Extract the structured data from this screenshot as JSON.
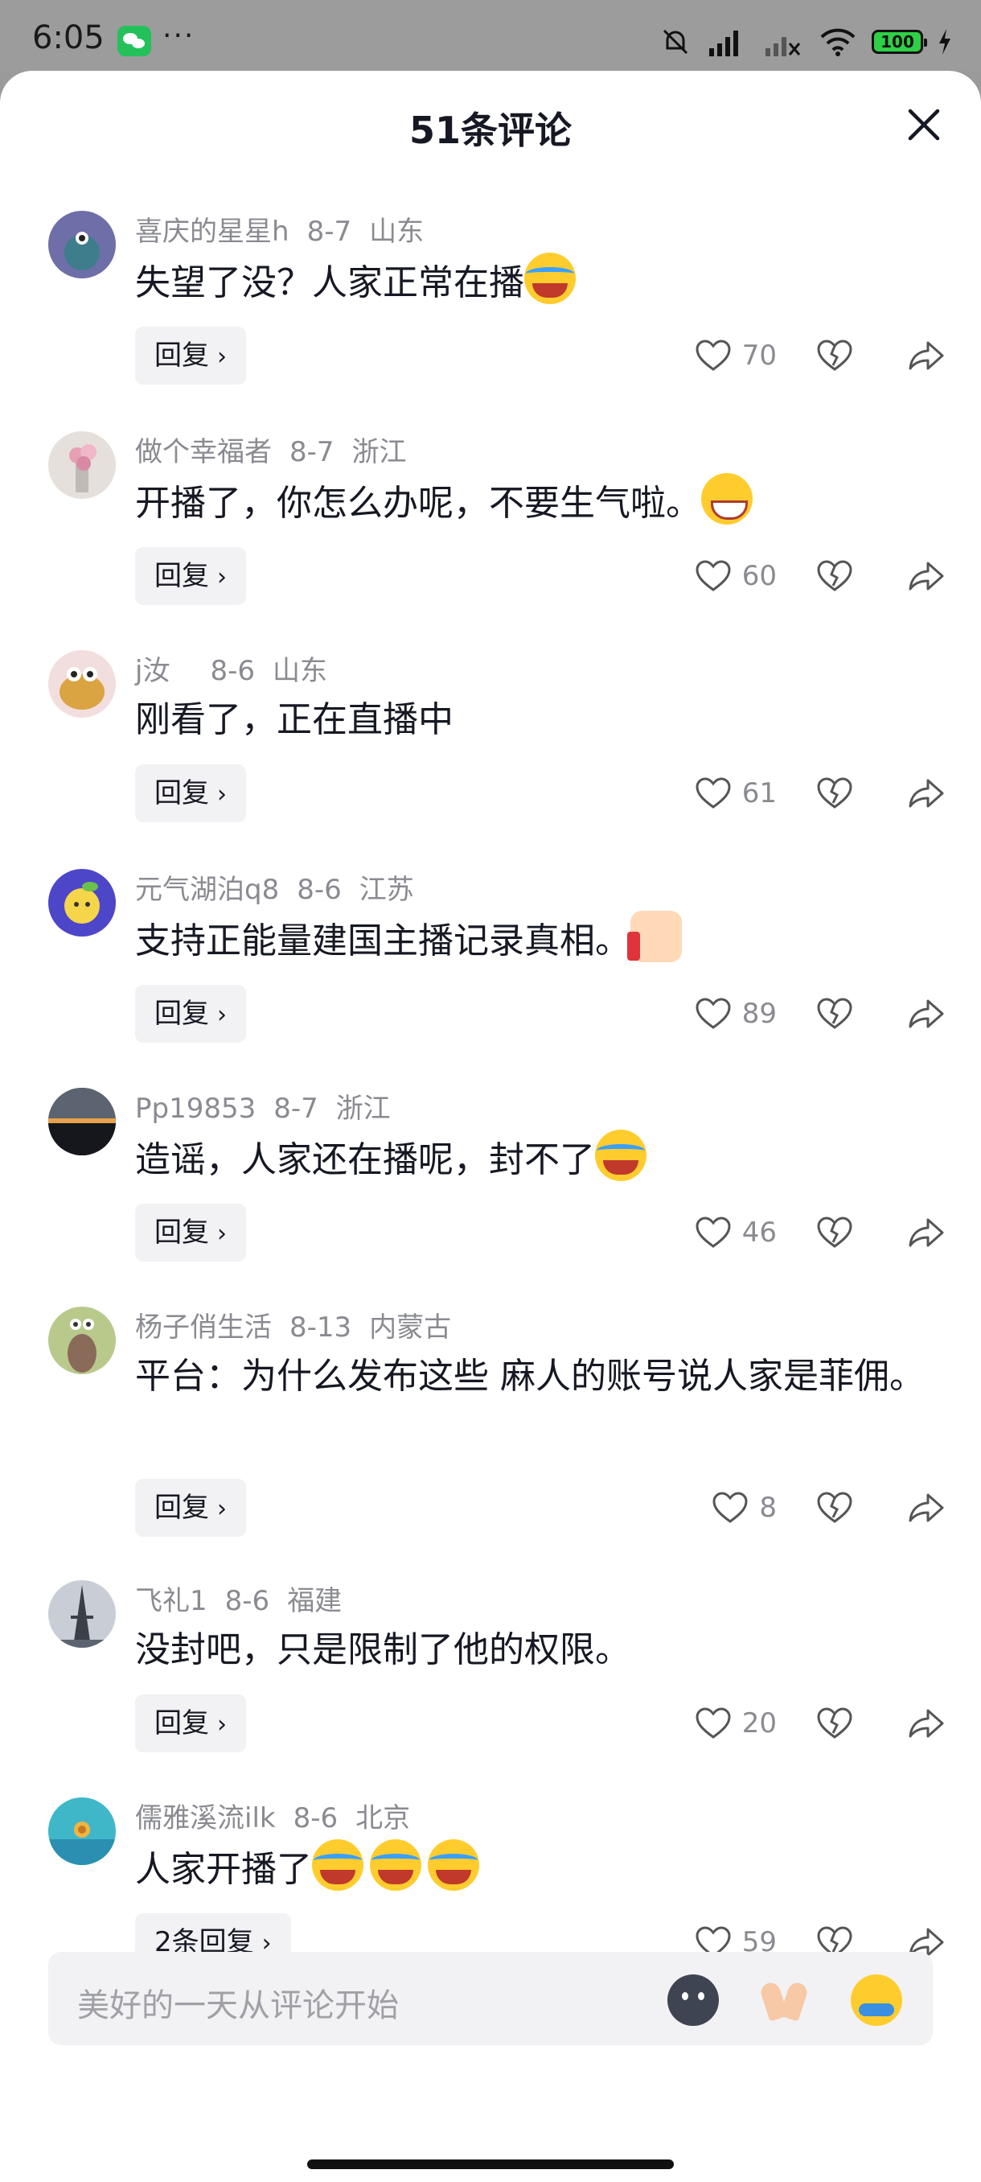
{
  "status_bar": {
    "time": "6:05",
    "battery": "100"
  },
  "sheet": {
    "title": "51条评论"
  },
  "comments": [
    {
      "user": "喜庆的星星h",
      "date": "8-7",
      "region": "山东",
      "text": "失望了没？人家正常在播",
      "reply_label": "回复",
      "likes": "70"
    },
    {
      "user": "做个幸福者",
      "date": "8-7",
      "region": "浙江",
      "text": "开播了，你怎么办呢，不要生气啦。",
      "reply_label": "回复",
      "likes": "60"
    },
    {
      "user": "j汝",
      "date": "8-6",
      "region": "山东",
      "text": "刚看了，正在直播中",
      "reply_label": "回复",
      "likes": "61"
    },
    {
      "user": "元气湖泊q8",
      "date": "8-6",
      "region": "江苏",
      "text": "支持正能量建国主播记录真相。",
      "reply_label": "回复",
      "likes": "89"
    },
    {
      "user": "Pp19853",
      "date": "8-7",
      "region": "浙江",
      "text": "造谣，人家还在播呢，封不了",
      "reply_label": "回复",
      "likes": "46"
    },
    {
      "user": "杨子俏生活",
      "date": "8-13",
      "region": "内蒙古",
      "text": "平台：为什么发布这些 麻人的账号说人家是菲佣。",
      "reply_label": "回复",
      "likes": "8"
    },
    {
      "user": "飞礼1",
      "date": "8-6",
      "region": "福建",
      "text": "没封吧，只是限制了他的权限。",
      "reply_label": "回复",
      "likes": "20"
    },
    {
      "user": "儒雅溪流ilk",
      "date": "8-6",
      "region": "北京",
      "text": "人家开播了",
      "reply_label": "2条回复",
      "likes": "59"
    }
  ],
  "input": {
    "placeholder": "美好的一天从评论开始"
  },
  "icons": {
    "close": "close-icon",
    "like": "heart-icon",
    "dislike": "broken-heart-icon",
    "share": "share-arrow-icon",
    "emoji_face": "laughing-crying-emoji",
    "emoji_grin": "grinning-emoji",
    "emoji_thumb": "thumbs-up-emoji"
  },
  "colors": {
    "sheet_bg": "#ffffff",
    "meta": "#8a8b91",
    "text": "#161823",
    "reply_bg": "#f2f2f4"
  }
}
